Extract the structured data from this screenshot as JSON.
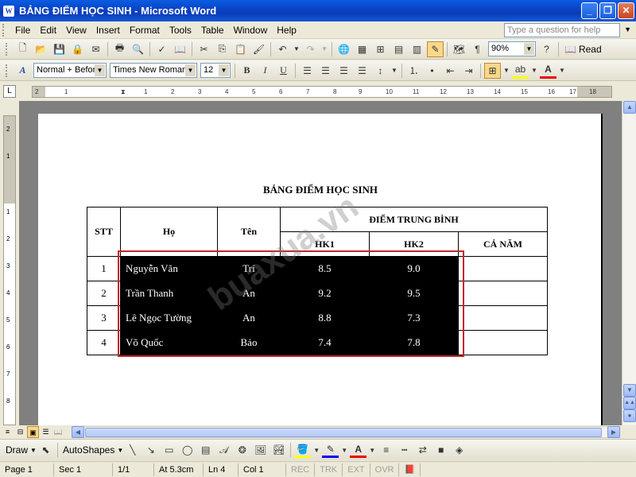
{
  "window": {
    "title": "BẢNG ĐIỂM HỌC SINH - Microsoft Word",
    "app_icon": "W"
  },
  "menu": {
    "items": [
      "File",
      "Edit",
      "View",
      "Insert",
      "Format",
      "Tools",
      "Table",
      "Window",
      "Help"
    ],
    "ask_placeholder": "Type a question for help"
  },
  "toolbar_standard": {
    "zoom": "90%",
    "read_label": "Read"
  },
  "toolbar_format": {
    "style": "Normal + Befor",
    "font": "Times New Roman",
    "size": "12",
    "bold": "B",
    "italic": "I",
    "underline": "U"
  },
  "ruler": {
    "h_ticks": [
      "2",
      "1",
      "1",
      "2",
      "3",
      "4",
      "5",
      "6",
      "7",
      "8",
      "9",
      "10",
      "11",
      "12",
      "13",
      "14",
      "15",
      "16",
      "17",
      "18"
    ],
    "v_ticks": [
      "2",
      "1",
      "1",
      "2",
      "3",
      "4",
      "5",
      "6",
      "7",
      "8"
    ]
  },
  "document": {
    "title": "BẢNG ĐIỂM HỌC SINH",
    "headers": {
      "stt": "STT",
      "ho": "Họ",
      "ten": "Tên",
      "dtb": "ĐIỂM TRUNG BÌNH",
      "hk1": "HK1",
      "hk2": "HK2",
      "ca_nam": "CẢ NĂM"
    },
    "rows": [
      {
        "stt": "1",
        "ho": "Nguyễn Văn",
        "ten": "Trí",
        "hk1": "8.5",
        "hk2": "9.0",
        "ca_nam": ""
      },
      {
        "stt": "2",
        "ho": "Trần Thanh",
        "ten": "An",
        "hk1": "9.2",
        "hk2": "9.5",
        "ca_nam": ""
      },
      {
        "stt": "3",
        "ho": "Lê Ngọc Tường",
        "ten": "An",
        "hk1": "8.8",
        "hk2": "7.3",
        "ca_nam": ""
      },
      {
        "stt": "4",
        "ho": "Võ Quốc",
        "ten": "Bảo",
        "hk1": "7.4",
        "hk2": "7.8",
        "ca_nam": ""
      }
    ],
    "watermark": "buaxua.vn"
  },
  "drawbar": {
    "draw_label": "Draw",
    "autoshapes_label": "AutoShapes"
  },
  "status": {
    "page": "Page 1",
    "sec": "Sec 1",
    "pages": "1/1",
    "at": "At 5.3cm",
    "ln": "Ln 4",
    "col": "Col 1",
    "rec": "REC",
    "trk": "TRK",
    "ext": "EXT",
    "ovr": "OVR"
  },
  "colors": {
    "titlebar": "#0a45c8",
    "selection": "#000000",
    "highlight_box": "#c0282d"
  }
}
